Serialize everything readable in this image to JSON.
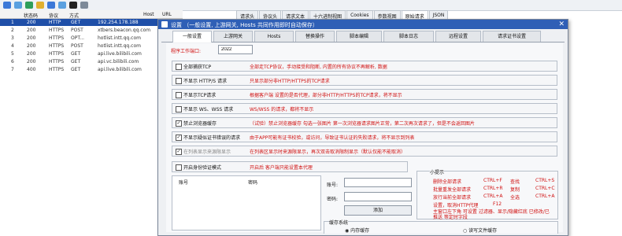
{
  "toolbar": {
    "icons": [
      "wrench-icon",
      "arrow-icon",
      "swap-icon",
      "pointer-icon",
      "refresh-icon",
      "image-icon",
      "terminal-icon",
      "search-icon"
    ]
  },
  "right_tabs": [
    "请求头",
    "协议头",
    "请求文本",
    "十六进制视图",
    "Cookies",
    "参数视图",
    "原始请求",
    "JSON"
  ],
  "grid": {
    "headers": [
      "状态码",
      "协议",
      "方式",
      "Host",
      "URL"
    ],
    "rows": [
      {
        "num": "1",
        "status": "200",
        "proto": "HTTP",
        "method": "GET",
        "host": "192.254.178.188"
      },
      {
        "num": "2",
        "status": "200",
        "proto": "HTTPS",
        "method": "POST",
        "host": "xtbers.beacon.qq.com"
      },
      {
        "num": "3",
        "status": "200",
        "proto": "HTTPS",
        "method": "OPT...",
        "host": "hotlist.intt.qq.com"
      },
      {
        "num": "4",
        "status": "200",
        "proto": "HTTPS",
        "method": "POST",
        "host": "hotlist.intt.qq.com"
      },
      {
        "num": "5",
        "status": "200",
        "proto": "HTTPS",
        "method": "GET",
        "host": "api.live.bilibili.com"
      },
      {
        "num": "6",
        "status": "200",
        "proto": "HTTPS",
        "method": "GET",
        "host": "api.vc.bilibili.com"
      },
      {
        "num": "7",
        "status": "400",
        "proto": "HTTPS",
        "method": "GET",
        "host": "api.live.bilibili.com"
      }
    ]
  },
  "dialog": {
    "title": "设置 （一般设置, 上游网关, Hosts 共同作用即时自动保存）",
    "tabs": [
      "一般设置",
      "上游网关",
      "Hosts",
      "替换操作",
      "脚本编辑",
      "脚本日志",
      "远程设置",
      "请求证书设置"
    ],
    "port_label": "程序工作端口:",
    "port_value": "2022",
    "options": [
      {
        "name": "全部捕获TCP",
        "desc": "全部走TCP协议，手动接受和阻断, 内置的所有协议不再解析, 数据",
        "checked": false
      },
      {
        "name": "不显示 HTTP/S 请求",
        "desc": "只显示部分非HTTP/HTTPS的TCP请求",
        "checked": false
      },
      {
        "name": "不显示TCP请求",
        "desc": "根据客户端 设置的是否代理，部分非HTTP/HTTPS的TCP请求，将不显示",
        "checked": false
      },
      {
        "name": "不显示 WS、WSS 请求",
        "desc": "WS/WSS 的请求，都将不显示",
        "checked": false
      },
      {
        "name": "禁止浏览器缓存",
        "desc": "（试验）禁止浏览器缓存 勾选一张图片 第一次浏览器请求图片正常，第二次再次请求了，但是不会返回图片",
        "checked": true
      },
      {
        "name": "不显示疑似证书错误的请求",
        "desc": "由于APP可能有证书校验，或访问，导致证书认证的失败请求，将不显示到列表",
        "checked": true
      },
      {
        "name": "在列表显示来源限显示",
        "desc": "在列表区显示时来源限显示，再次双击取消限制显示（默认仅能不能取消）",
        "checked": true
      },
      {
        "name": "开启身份验证模式",
        "desc": "开启后 客户端只能设置本代理",
        "checked": false
      }
    ],
    "accounts": {
      "col_user": "账号",
      "col_pass": "密码",
      "user_label": "账号:",
      "pass_label": "密码:",
      "add_button": "添加"
    },
    "tips": {
      "title": "小提示",
      "shortcuts": [
        {
          "name": "删除全部请求",
          "key": "CTRL+F",
          "name2": "查找",
          "key2": "CTRL+S"
        },
        {
          "name": "批量重发全部请求",
          "key": "CTRL+R",
          "name2": "复制",
          "key2": "CTRL+C"
        },
        {
          "name": "放行当前全部请求",
          "key": "CTRL+A",
          "name2": "全选",
          "key2": "CTRL+A"
        },
        {
          "name": "设置，取消HTTP代理",
          "key": "F12",
          "name2": "",
          "key2": ""
        }
      ],
      "note": "主窗口左下角 可设置 过滤器、显示/隐藏红底 已修改/已推送 等定时字段"
    },
    "cache": {
      "title": "缓存系统",
      "opt1": "内存缓存",
      "opt2": "读写文件缓存"
    }
  },
  "colors": {
    "accent": "#2f5fb6",
    "red": "#d01010",
    "selected": "#1f4fa8"
  }
}
